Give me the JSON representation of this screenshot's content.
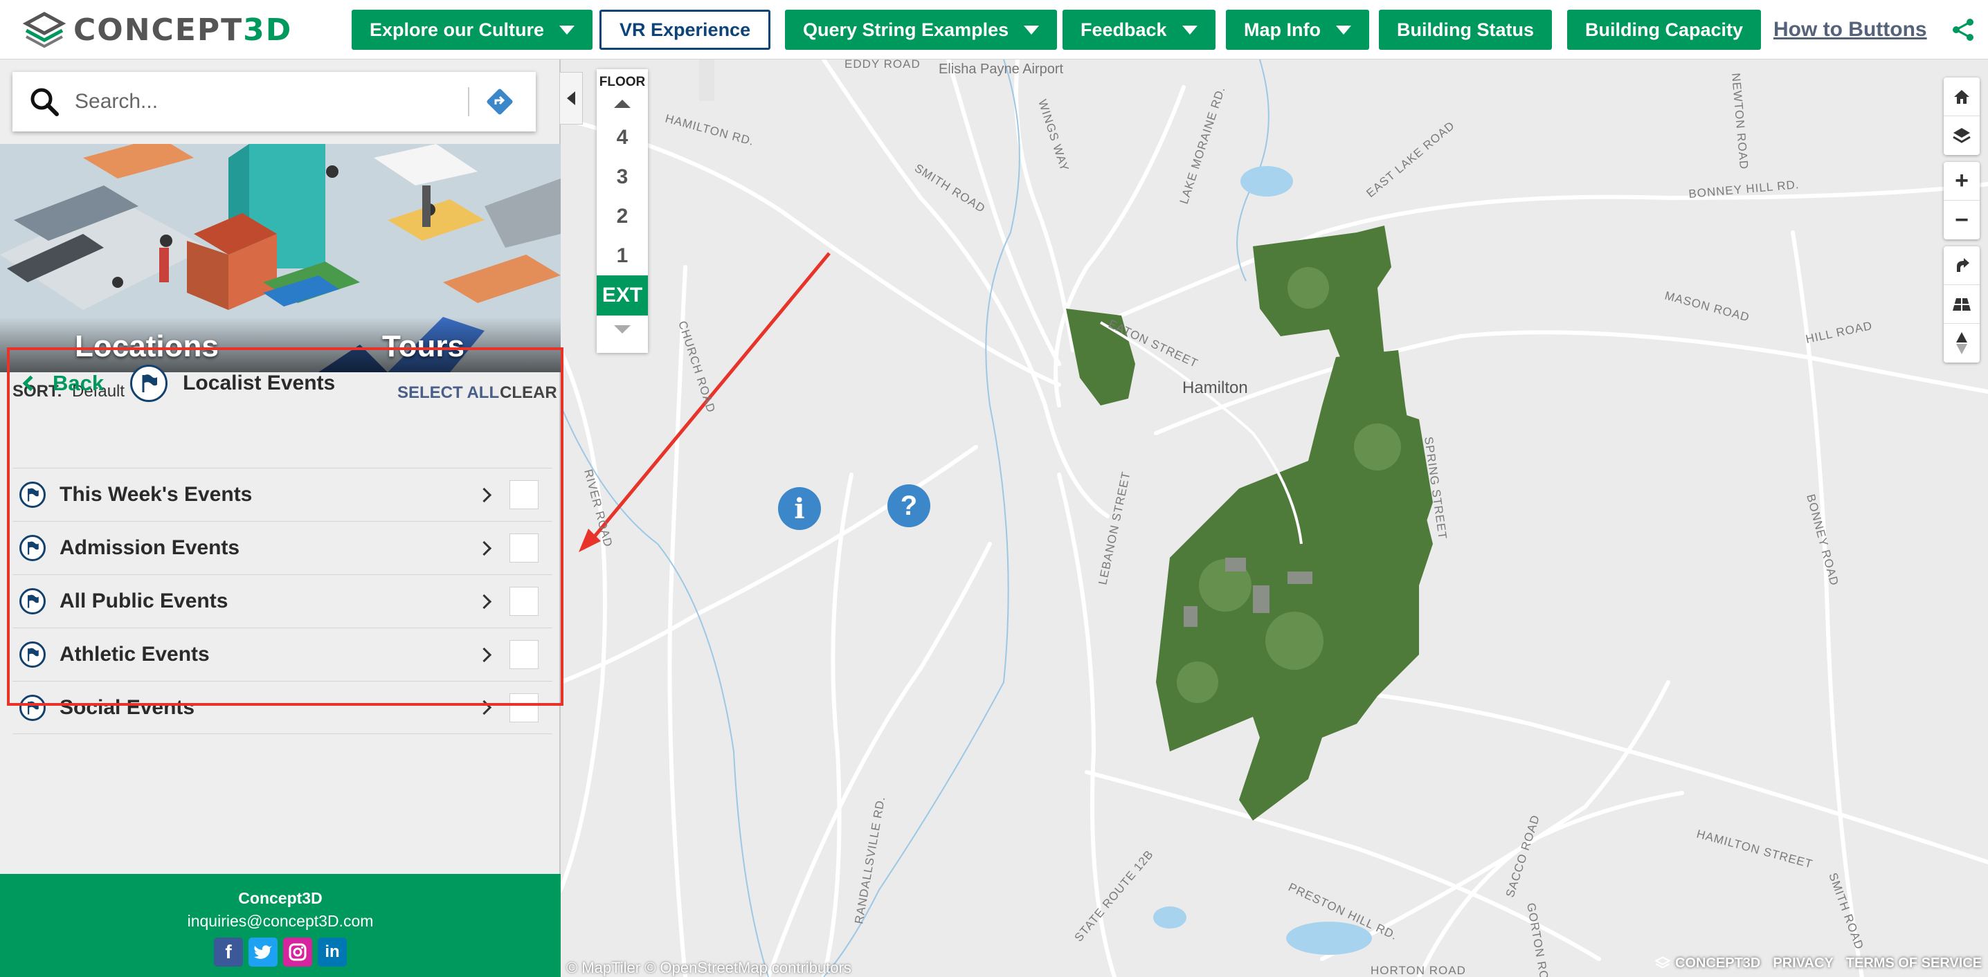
{
  "header": {
    "logo_text": "CONCEPT3D",
    "nav": [
      {
        "label": "Explore our Culture",
        "dropdown": true
      },
      {
        "label": "VR Experience",
        "dropdown": false
      },
      {
        "label": "Query String Examples",
        "dropdown": true
      },
      {
        "label": "Feedback",
        "dropdown": true
      },
      {
        "label": "Map Info",
        "dropdown": true
      },
      {
        "label": "Building Status",
        "dropdown": false
      },
      {
        "label": "Building Capacity",
        "dropdown": false
      }
    ],
    "how_to_link": "How to Buttons",
    "share_icon": "share-icon"
  },
  "search": {
    "placeholder": "Search..."
  },
  "banner": {
    "left_label": "Locations",
    "right_label": "Tours"
  },
  "sortbar": {
    "sort_label": "SORT:",
    "sort_value": "Default",
    "select_all": "SELECT ALL",
    "clear": "CLEAR"
  },
  "category": {
    "back_label": "Back",
    "title": "Localist Events",
    "icon": "flag-icon"
  },
  "events": [
    {
      "label": "This Week's Events"
    },
    {
      "label": "Admission Events"
    },
    {
      "label": "All Public Events"
    },
    {
      "label": "Athletic Events"
    },
    {
      "label": "Social Events"
    }
  ],
  "footer": {
    "name": "Concept3D",
    "email": "inquiries@concept3D.com",
    "socials": [
      "facebook",
      "twitter",
      "instagram",
      "linkedin"
    ]
  },
  "floor": {
    "title": "FLOOR",
    "levels": [
      "4",
      "3",
      "2",
      "1"
    ],
    "selected": "EXT"
  },
  "map": {
    "town": "Hamilton",
    "roads": [
      "EDDY ROAD",
      "HAMILTON RD.",
      "SMITH ROAD",
      "WINGS WAY",
      "LAKE MORAINE RD.",
      "EAST LAKE ROAD",
      "NEWTON ROAD",
      "BONNEY HILL RD.",
      "MASON ROAD",
      "HILL ROAD",
      "CHURCH ROAD",
      "EATON STREET",
      "RIVER ROAD",
      "LEBANON STREET",
      "SPRING STREET",
      "BONNEY ROAD",
      "HAMILTON STREET",
      "PRESTON HILL RD.",
      "SACCO ROAD",
      "GORTON ROAD",
      "HORTON ROAD",
      "STATE ROUTE 12B",
      "RANDALLSVILLE RD.",
      "SMITH ROAD"
    ],
    "airport": "Elisha Payne Airport",
    "attribution": "© MapTiler © OpenStreetMap contributors",
    "footer_logo": "CONCEPT3D",
    "privacy": "PRIVACY",
    "terms": "TERMS OF SERVICE"
  },
  "colors": {
    "brand_green": "#00995d",
    "navy": "#13416e",
    "highlight_red": "#e8332a",
    "info_blue": "#3b87c9"
  }
}
